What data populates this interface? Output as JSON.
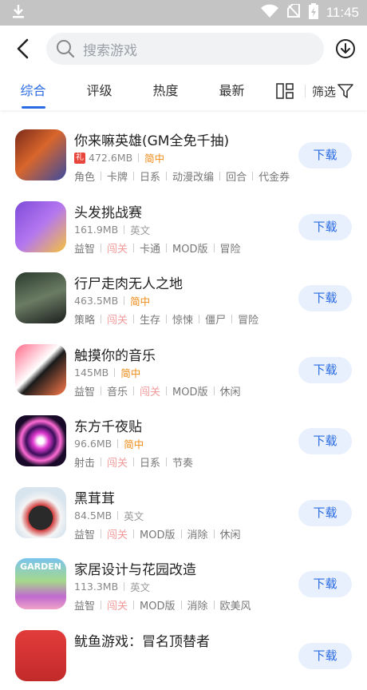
{
  "statusbar": {
    "time": "11:45"
  },
  "search": {
    "placeholder": "搜索游戏"
  },
  "tabs": [
    {
      "label": "综合",
      "active": true
    },
    {
      "label": "评级"
    },
    {
      "label": "热度"
    },
    {
      "label": "最新"
    }
  ],
  "filter_label": "筛选",
  "colors": {
    "accent": "#2a6be3",
    "button_bg": "#e8f0fd",
    "chinese_tag": "#ef8a16",
    "highlight_tag": "#f29a9a"
  },
  "apps": [
    {
      "name": "你来嘛英雄(GM全免千抽)",
      "gift": "礼",
      "size": "472.6MB",
      "lang": "简中",
      "lang_cn": true,
      "tags": [
        "角色",
        "卡牌",
        "日系",
        "动漫改编",
        "回合",
        "代金券"
      ],
      "hl": [],
      "button": "下载",
      "icon": "hero-game-icon"
    },
    {
      "name": "头发挑战赛",
      "size": "161.9MB",
      "lang": "英文",
      "lang_cn": false,
      "tags": [
        "益智",
        "闯关",
        "卡通",
        "MOD版",
        "冒险"
      ],
      "hl": [
        1
      ],
      "button": "下载",
      "icon": "hair-challenge-icon"
    },
    {
      "name": "行尸走肉无人之地",
      "size": "463.5MB",
      "lang": "简中",
      "lang_cn": true,
      "tags": [
        "策略",
        "闯关",
        "生存",
        "惊悚",
        "僵尸",
        "冒险"
      ],
      "hl": [
        1
      ],
      "button": "下载",
      "icon": "walking-dead-icon"
    },
    {
      "name": "触摸你的音乐",
      "size": "145MB",
      "lang": "简中",
      "lang_cn": true,
      "tags": [
        "益智",
        "音乐",
        "闯关",
        "MOD版",
        "休闲"
      ],
      "hl": [
        2
      ],
      "button": "下载",
      "icon": "piano-tiles-icon"
    },
    {
      "name": "东方千夜贴",
      "size": "96.6MB",
      "lang": "简中",
      "lang_cn": true,
      "tags": [
        "射击",
        "闯关",
        "日系",
        "节奏"
      ],
      "hl": [
        1
      ],
      "button": "下载",
      "icon": "touhou-icon"
    },
    {
      "name": "黑茸茸",
      "size": "84.5MB",
      "lang": "英文",
      "lang_cn": false,
      "tags": [
        "益智",
        "闯关",
        "MOD版",
        "消除",
        "休闲"
      ],
      "hl": [
        1
      ],
      "button": "下载",
      "icon": "black-fluffy-icon"
    },
    {
      "name": "家居设计与花园改造",
      "size": "113.3MB",
      "lang": "英文",
      "lang_cn": false,
      "tags": [
        "益智",
        "闯关",
        "MOD版",
        "消除",
        "欧美风"
      ],
      "hl": [
        1
      ],
      "button": "下载",
      "icon": "garden-design-icon",
      "icon_text": "GARDEN"
    },
    {
      "name": "鱿鱼游戏：冒名顶替者",
      "size": "",
      "lang": "",
      "lang_cn": false,
      "tags": [],
      "hl": [],
      "button": "下载",
      "icon": "squid-game-icon"
    }
  ]
}
